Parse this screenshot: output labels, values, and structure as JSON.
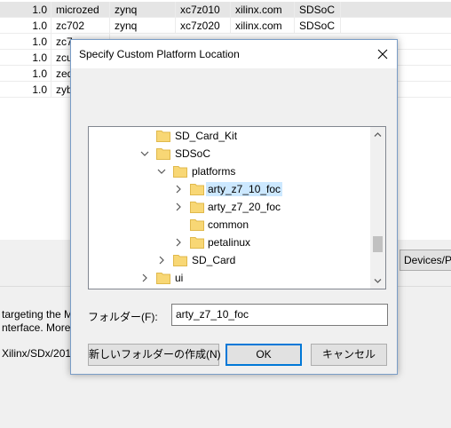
{
  "background": {
    "table_rows": [
      {
        "version": "1.0",
        "name": "microzed",
        "arch": "zynq",
        "part": "xc7z010",
        "vendor": "xilinx.com",
        "type": "SDSoC",
        "selected": true
      },
      {
        "version": "1.0",
        "name": "zc702",
        "arch": "zynq",
        "part": "xc7z020",
        "vendor": "xilinx.com",
        "type": "SDSoC",
        "selected": false
      },
      {
        "version": "1.0",
        "name": "zc7",
        "arch": "",
        "part": "",
        "vendor": "",
        "type": "",
        "selected": false
      },
      {
        "version": "1.0",
        "name": "zcu",
        "arch": "",
        "part": "",
        "vendor": "",
        "type": "",
        "selected": false
      },
      {
        "version": "1.0",
        "name": "zed",
        "arch": "",
        "part": "",
        "vendor": "",
        "type": "",
        "selected": false
      },
      {
        "version": "1.0",
        "name": "zyb",
        "arch": "",
        "part": "",
        "vendor": "",
        "type": "",
        "selected": false
      }
    ],
    "devices_button_label": "Devices/Pl",
    "description_lines": [
      "targeting the M",
      "nterface. More",
      "Xilinx/SDx/201"
    ]
  },
  "dialog": {
    "title": "Specify Custom Platform Location",
    "tree": [
      {
        "label": "SD_Card_Kit",
        "expander": "none",
        "selected": false
      },
      {
        "label": "SDSoC",
        "expander": "expanded",
        "selected": false
      },
      {
        "label": "platforms",
        "expander": "expanded",
        "selected": false
      },
      {
        "label": "arty_z7_10_foc",
        "expander": "collapsed",
        "selected": true
      },
      {
        "label": "arty_z7_20_foc",
        "expander": "collapsed",
        "selected": false
      },
      {
        "label": "common",
        "expander": "none",
        "selected": false
      },
      {
        "label": "petalinux",
        "expander": "collapsed",
        "selected": false
      },
      {
        "label": "SD_Card",
        "expander": "collapsed",
        "selected": false
      },
      {
        "label": "ui",
        "expander": "collapsed",
        "selected": false
      }
    ],
    "folder_field_label": "フォルダー(F):",
    "folder_field_value": "arty_z7_10_foc",
    "new_folder_button": "新しいフォルダーの作成(N)",
    "ok_button": "OK",
    "cancel_button": "キャンセル"
  },
  "colors": {
    "selection": "#cce8ff",
    "folder": "#f8d775",
    "accent": "#0078d7"
  }
}
